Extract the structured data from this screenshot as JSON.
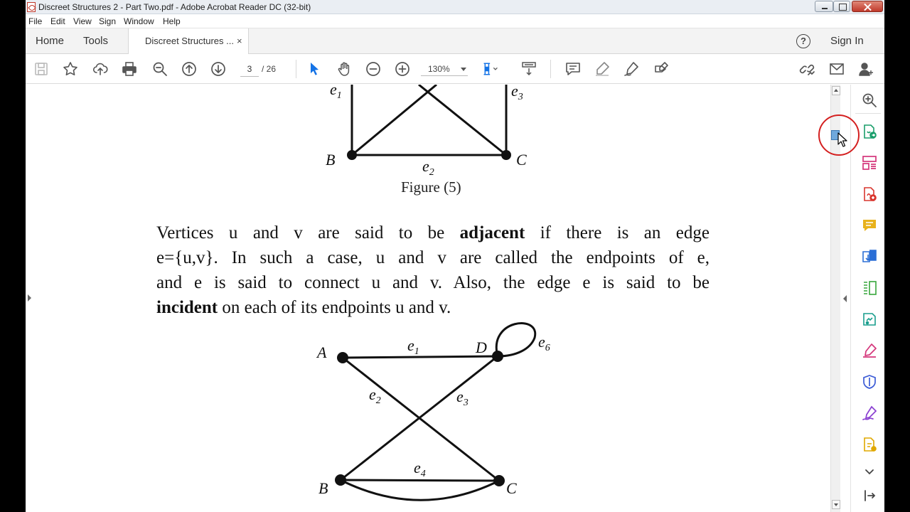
{
  "window": {
    "title": "Discreet Structures 2 - Part Two.pdf - Adobe Acrobat Reader DC (32-bit)"
  },
  "menu": {
    "items": [
      "File",
      "Edit",
      "View",
      "Sign",
      "Window",
      "Help"
    ]
  },
  "tabs": {
    "home": "Home",
    "tools": "Tools",
    "document": "Discreet Structures ...",
    "close": "×",
    "help": "?",
    "sign_in": "Sign In"
  },
  "toolbar": {
    "current_page": "3",
    "total_pages": "/ 26",
    "zoom": "130%",
    "icons": [
      "save-icon",
      "bookmark-star-icon",
      "upload-icon",
      "print-icon",
      "find-icon",
      "prev-page-icon",
      "next-page-icon",
      "select-arrow-icon",
      "hand-icon",
      "zoom-out-icon",
      "zoom-in-icon",
      "page-fit-icon",
      "scroll-mode-icon",
      "comment-icon",
      "highlight-icon",
      "sign-icon",
      "fill-sign-icon",
      "share-link-icon",
      "email-icon",
      "add-user-icon"
    ]
  },
  "document": {
    "figure5": {
      "labels": {
        "e1": "e",
        "e1_sub": "1",
        "e3": "e",
        "e3_sub": "3",
        "B": "B",
        "C": "C",
        "e2": "e",
        "e2_sub": "2"
      },
      "caption": "Figure (5)"
    },
    "paragraph": {
      "l1_a": "Vertices u and v are said to be ",
      "l1_bold": "adjacent",
      "l1_b": " if there is an edge",
      "l2": "e={u,v}. In such a case, u and v are called the endpoints of e,",
      "l3": "and e is said to connect u and v. Also, the edge e is said to be",
      "l4_bold": "incident",
      "l4_b": " on each of its endpoints u and v."
    },
    "figure6": {
      "labels": {
        "A": "A",
        "D": "D",
        "B": "B",
        "C": "C",
        "e1": "e",
        "e1_sub": "1",
        "e2": "e",
        "e2_sub": "2",
        "e3": "e",
        "e3_sub": "3",
        "e4": "e",
        "e4_sub": "4",
        "e6": "e",
        "e6_sub": "6"
      }
    }
  },
  "right_pane": {
    "icons": [
      "search-zoom-icon",
      "export-pdf-icon",
      "organize-pages-icon",
      "create-pdf-icon",
      "comment-icon",
      "combine-files-icon",
      "edit-pdf-icon",
      "send-for-review-icon",
      "fill-sign-icon",
      "protect-icon",
      "sign-icon",
      "more-tools-icon",
      "expand-down-icon",
      "collapse-pane-icon"
    ]
  },
  "colors": {
    "accent_blue": "#1473e6",
    "highlight_ring": "#d42020"
  }
}
